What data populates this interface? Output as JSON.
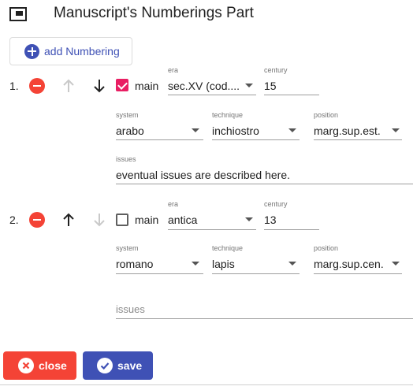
{
  "page": {
    "title": "Manuscript's Numberings Part"
  },
  "toolbar": {
    "add_label": "add Numbering"
  },
  "numberings": [
    {
      "index": "1.",
      "main_label": "main",
      "main_checked": true,
      "era": {
        "label": "era",
        "value": "sec.XV (cod...."
      },
      "century": {
        "label": "century",
        "value": "15"
      },
      "system": {
        "label": "system",
        "value": "arabo"
      },
      "technique": {
        "label": "technique",
        "value": "inchiostro"
      },
      "position": {
        "label": "position",
        "value": "marg.sup.est."
      },
      "issues": {
        "label": "issues",
        "value": "eventual issues are described here."
      }
    },
    {
      "index": "2.",
      "main_label": "main",
      "main_checked": false,
      "era": {
        "label": "era",
        "value": "antica"
      },
      "century": {
        "label": "century",
        "value": "13"
      },
      "system": {
        "label": "system",
        "value": "romano"
      },
      "technique": {
        "label": "technique",
        "value": "lapis"
      },
      "position": {
        "label": "position",
        "value": "marg.sup.cen."
      },
      "issues": {
        "placeholder": "issues"
      }
    }
  ],
  "actions": {
    "close_label": "close",
    "save_label": "save"
  },
  "colors": {
    "primary": "#3f51b5",
    "warn": "#f44336",
    "accent": "#e91e63"
  },
  "icons": {
    "title": "window-icon",
    "add": "add-circle-icon",
    "remove": "remove-circle-icon",
    "up": "arrow-up-icon",
    "down": "arrow-down-icon",
    "close": "cancel-icon",
    "save": "check-circle-icon"
  }
}
